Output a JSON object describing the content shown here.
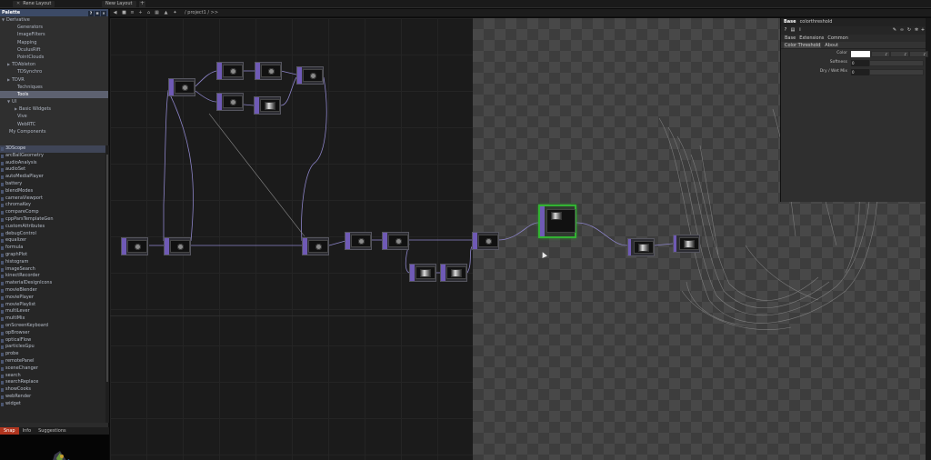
{
  "top_tabs": [
    {
      "label": "Rene Layout"
    },
    {
      "label": "New Layout"
    }
  ],
  "palette": {
    "title": "Palette",
    "tree": [
      {
        "label": "Derivative",
        "arrow": "▼",
        "indent": 2,
        "selected": false
      },
      {
        "label": "Generators",
        "arrow": "",
        "indent": 14,
        "selected": false
      },
      {
        "label": "ImageFilters",
        "arrow": "",
        "indent": 14,
        "selected": false
      },
      {
        "label": "Mapping",
        "arrow": "",
        "indent": 14,
        "selected": false
      },
      {
        "label": "OculusRift",
        "arrow": "",
        "indent": 14,
        "selected": false
      },
      {
        "label": "PointClouds",
        "arrow": "",
        "indent": 14,
        "selected": false
      },
      {
        "label": "TDAbleton",
        "arrow": "▶",
        "indent": 8,
        "selected": false
      },
      {
        "label": "TDSynchro",
        "arrow": "",
        "indent": 14,
        "selected": false
      },
      {
        "label": "TDVR",
        "arrow": "▶",
        "indent": 8,
        "selected": false
      },
      {
        "label": "Techniques",
        "arrow": "",
        "indent": 14,
        "selected": false
      },
      {
        "label": "Tools",
        "arrow": "",
        "indent": 14,
        "selected": true
      },
      {
        "label": "UI",
        "arrow": "▼",
        "indent": 8,
        "selected": false
      },
      {
        "label": "Basic Widgets",
        "arrow": "▶",
        "indent": 16,
        "selected": false
      },
      {
        "label": "Vive",
        "arrow": "",
        "indent": 14,
        "selected": false
      },
      {
        "label": "WebRTC",
        "arrow": "",
        "indent": 14,
        "selected": false
      },
      {
        "label": "My Components",
        "arrow": "",
        "indent": 5,
        "selected": false
      }
    ],
    "items": [
      "3DScope",
      "arcBallGeometry",
      "audioAnalysis",
      "audioSet",
      "autoMediaPlayer",
      "battery",
      "blendModes",
      "cameraViewport",
      "chromaKey",
      "compareComp",
      "cppParsTemplateGen",
      "customAttributes",
      "debugControl",
      "equalizer",
      "formula",
      "graphPlot",
      "histogram",
      "imageSearch",
      "kinectRecorder",
      "materialDesignIcons",
      "movieBlender",
      "moviePlayer",
      "moviePlaylist",
      "multiLever",
      "multiMix",
      "onScreenKeyboard",
      "opBrowser",
      "opticalFlow",
      "particlesGpu",
      "probe",
      "remotePanel",
      "sceneChanger",
      "search",
      "searchReplace",
      "showCooks",
      "webRender",
      "widget"
    ],
    "selected_item": "3DScope",
    "bottom_tabs": [
      "Snap",
      "Info",
      "Suggestions"
    ],
    "active_bottom_tab": "Snap"
  },
  "network": {
    "path": "/ project1 / >> "
  },
  "params": {
    "op_type": "Base",
    "op_name": "colorthreshold",
    "tabs": [
      "Base",
      "Extensions",
      "Common"
    ],
    "page_tabs": [
      "Color Threshold",
      "About"
    ],
    "active_page": "Color Threshold",
    "rows": [
      {
        "label": "Color",
        "kind": "color",
        "value": ""
      },
      {
        "label": "Softness",
        "kind": "value",
        "value": "0"
      },
      {
        "label": "Dry / Wet Mix",
        "kind": "value",
        "value": "0"
      }
    ]
  },
  "colors": {
    "selection": "#33b233",
    "palette_header": "#3c4a66",
    "snap_tab": "#b0351f",
    "comp_purple": "#6f5ab5"
  }
}
